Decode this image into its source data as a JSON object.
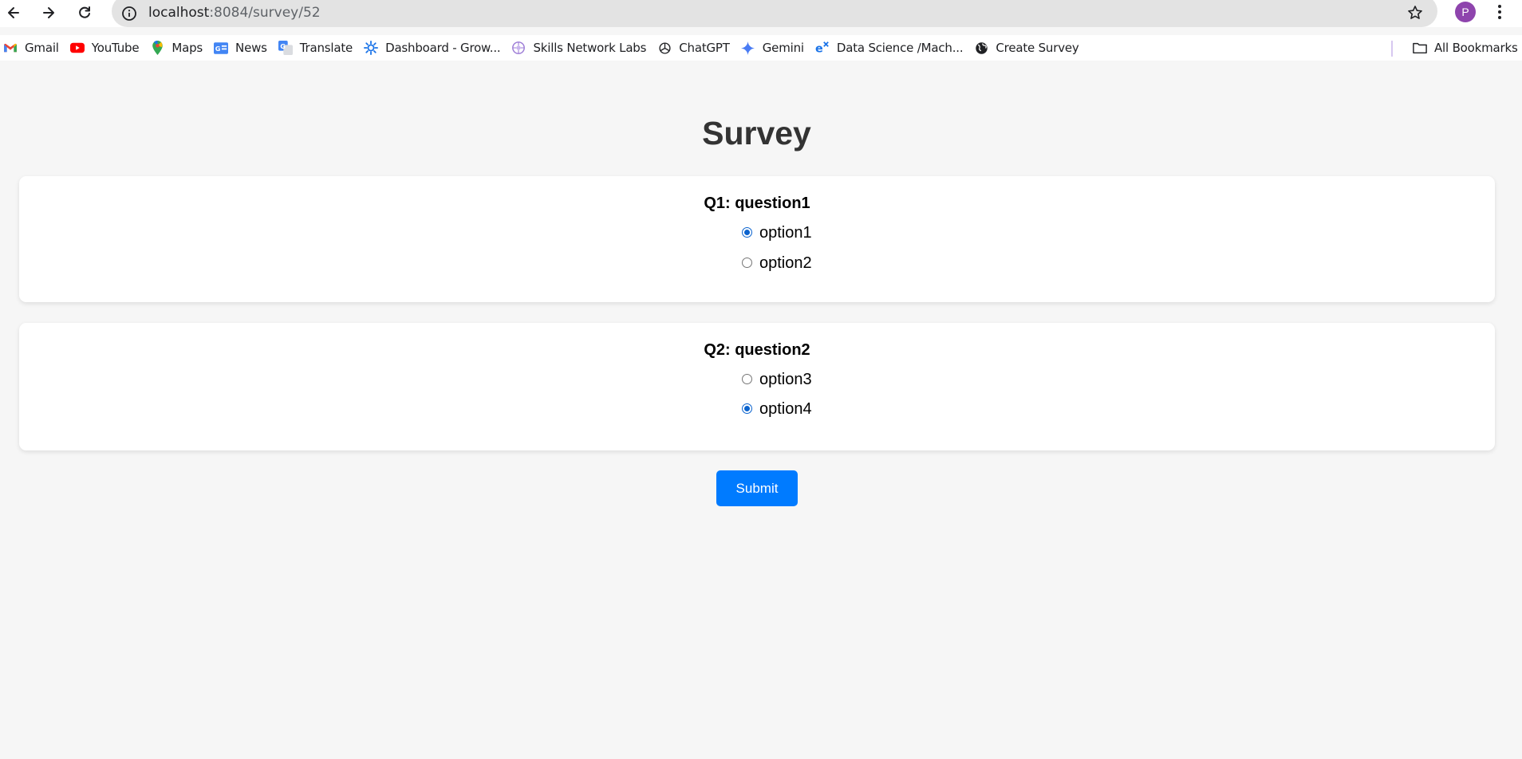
{
  "browser": {
    "url_host": "localhost",
    "url_rest": ":8084/survey/52",
    "profile_initial": "P"
  },
  "bookmarks": {
    "items": [
      {
        "label": "Gmail",
        "icon": "gmail-icon"
      },
      {
        "label": "YouTube",
        "icon": "youtube-icon"
      },
      {
        "label": "Maps",
        "icon": "maps-icon"
      },
      {
        "label": "News",
        "icon": "news-icon"
      },
      {
        "label": "Translate",
        "icon": "translate-icon"
      },
      {
        "label": "Dashboard - Grow...",
        "icon": "dashboard-icon"
      },
      {
        "label": "Skills Network Labs",
        "icon": "skills-network-icon"
      },
      {
        "label": "ChatGPT",
        "icon": "chatgpt-icon"
      },
      {
        "label": "Gemini",
        "icon": "gemini-icon"
      },
      {
        "label": "Data Science /Mach...",
        "icon": "data-science-icon"
      },
      {
        "label": "Create Survey",
        "icon": "globe-icon"
      }
    ],
    "all_bookmarks_label": "All Bookmarks"
  },
  "page": {
    "title": "Survey",
    "questions": [
      {
        "title": "Q1: question1",
        "options": [
          {
            "label": "option1",
            "checked": true
          },
          {
            "label": "option2",
            "checked": false
          }
        ]
      },
      {
        "title": "Q2: question2",
        "options": [
          {
            "label": "option3",
            "checked": false
          },
          {
            "label": "option4",
            "checked": true
          }
        ]
      }
    ],
    "submit_label": "Submit"
  },
  "colors": {
    "background": "#f6f6f6",
    "card": "#ffffff",
    "accent": "#007bff",
    "radio_checked": "#0b63ce"
  }
}
